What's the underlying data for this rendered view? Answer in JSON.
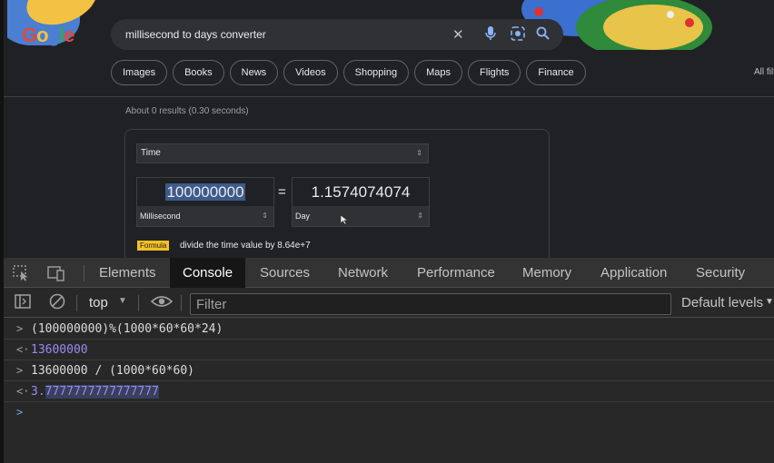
{
  "google": {
    "logo": "Google",
    "search_query": "millisecond to days converter",
    "chips": [
      "Images",
      "Books",
      "News",
      "Videos",
      "Shopping",
      "Maps",
      "Flights",
      "Finance"
    ],
    "all_filters": "All filte",
    "stats": "About 0 results (0.30 seconds)",
    "converter": {
      "category": "Time",
      "left_value": "100000000",
      "left_unit": "Millisecond",
      "equals": "=",
      "right_value": "1.1574074074",
      "right_unit": "Day",
      "formula_label": "Formula",
      "formula_text": "divide the time value by 8.64e+7"
    }
  },
  "devtools": {
    "tabs": [
      "Elements",
      "Console",
      "Sources",
      "Network",
      "Performance",
      "Memory",
      "Application",
      "Security"
    ],
    "active_tab": "Console",
    "context": "top",
    "filter_placeholder": "Filter",
    "levels": "Default levels",
    "console": {
      "input1": "(100000000)%(1000*60*60*24)",
      "output1": "13600000",
      "input2": "13600000 / (1000*60*60)",
      "output2_prefix": "3.",
      "output2_highlight": "7777777777777777"
    }
  },
  "colors": {
    "console_output": "#9a8af5",
    "active_tab_bg": "#161616",
    "formula_badge": "#f6c026"
  }
}
